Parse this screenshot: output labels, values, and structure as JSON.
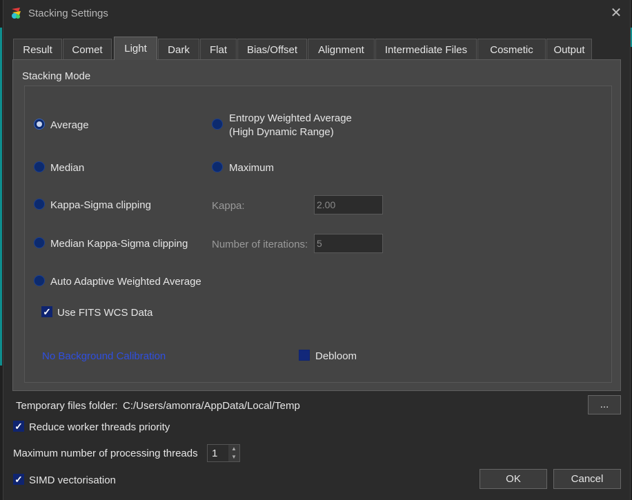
{
  "window": {
    "title": "Stacking Settings",
    "close_glyph": "✕"
  },
  "tabs": [
    {
      "label": "Result"
    },
    {
      "label": "Comet"
    },
    {
      "label": "Light",
      "active": true
    },
    {
      "label": "Dark"
    },
    {
      "label": "Flat"
    },
    {
      "label": "Bias/Offset"
    },
    {
      "label": "Alignment"
    },
    {
      "label": "Intermediate Files"
    },
    {
      "label": "Cosmetic"
    },
    {
      "label": "Output"
    }
  ],
  "light": {
    "group_title": "Stacking Mode",
    "modes": {
      "average": "Average",
      "entropy_line1": "Entropy Weighted Average",
      "entropy_line2": "(High Dynamic Range)",
      "median": "Median",
      "maximum": "Maximum",
      "kappa_sigma": "Kappa-Sigma clipping",
      "median_kappa_sigma": "Median Kappa-Sigma clipping",
      "auto_adaptive": "Auto Adaptive Weighted Average"
    },
    "selected_mode": "Average",
    "kappa_label": "Kappa:",
    "kappa_value": "2.00",
    "iterations_label": "Number of iterations:",
    "iterations_value": "5",
    "use_fits_label": "Use FITS WCS Data",
    "use_fits_checked": true,
    "background_link": "No Background Calibration",
    "debloom_label": "Debloom",
    "debloom_checked": false
  },
  "footer": {
    "temp_label": "Temporary files folder:",
    "temp_path": "C:/Users/amonra/AppData/Local/Temp",
    "browse_label": "...",
    "reduce_priority_label": "Reduce worker threads priority",
    "reduce_priority_checked": true,
    "max_threads_label": "Maximum number of processing threads",
    "max_threads_value": "1",
    "simd_label": "SIMD vectorisation",
    "simd_checked": true,
    "ok_label": "OK",
    "cancel_label": "Cancel"
  },
  "colors": {
    "accent_blue": "#0f2470",
    "link": "#2f4fe0",
    "background": "#2b2b2b"
  }
}
